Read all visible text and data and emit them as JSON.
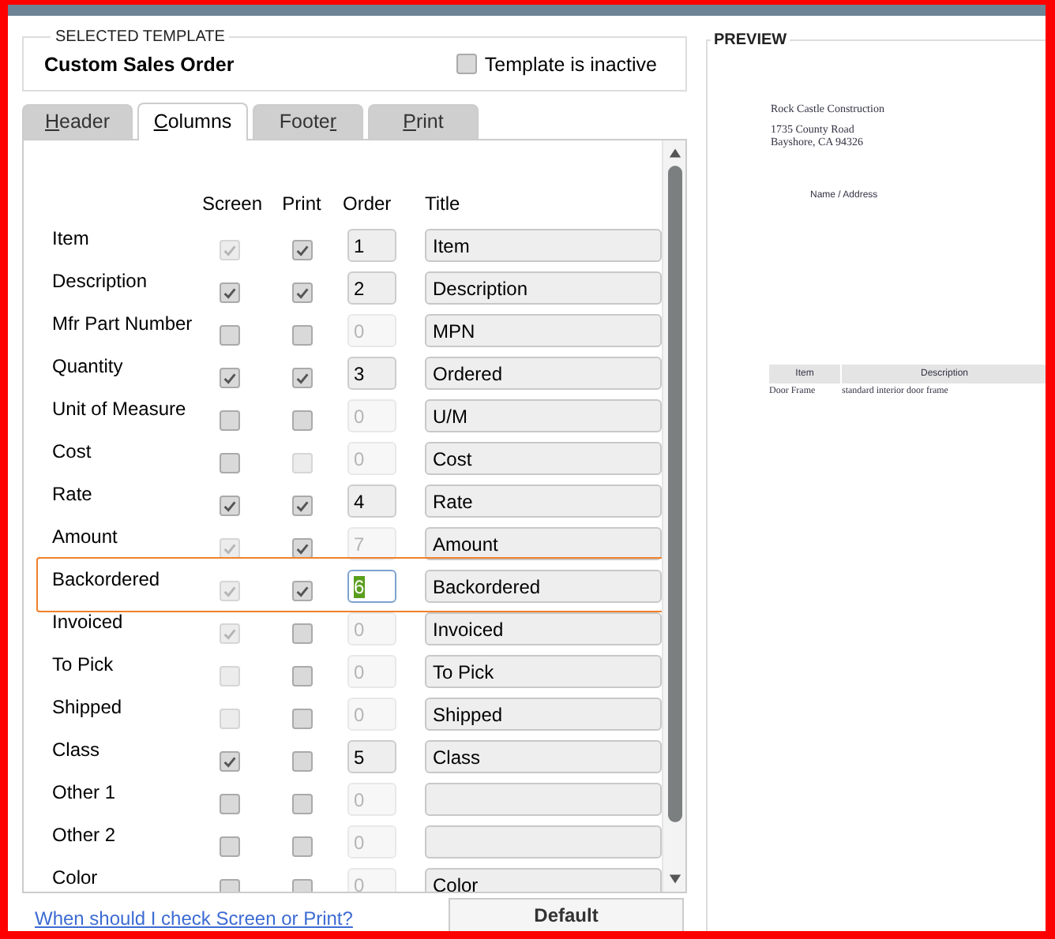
{
  "template": {
    "legend": "SELECTED TEMPLATE",
    "name": "Custom Sales Order",
    "inactive_label": "Template is inactive",
    "inactive": false
  },
  "tabs": [
    {
      "key": "H",
      "after": "eader",
      "selected": false
    },
    {
      "key": "C",
      "after": "olumns",
      "selected": true
    },
    {
      "before": "Foote",
      "key": "r",
      "selected": false
    },
    {
      "key": "P",
      "after": "rint",
      "selected": false
    }
  ],
  "headers": {
    "screen": "Screen",
    "print": "Print",
    "order": "Order",
    "title": "Title"
  },
  "rows": [
    {
      "label": "Item",
      "screen": {
        "checked": true,
        "disabled": true
      },
      "print": {
        "checked": true,
        "disabled": false
      },
      "order": {
        "value": "1",
        "disabled": false,
        "focused": false
      },
      "title": "Item",
      "highlighted": false
    },
    {
      "label": "Description",
      "screen": {
        "checked": true,
        "disabled": false
      },
      "print": {
        "checked": true,
        "disabled": false
      },
      "order": {
        "value": "2",
        "disabled": false,
        "focused": false
      },
      "title": "Description",
      "highlighted": false
    },
    {
      "label": "Mfr Part Number",
      "screen": {
        "checked": false,
        "disabled": false
      },
      "print": {
        "checked": false,
        "disabled": false
      },
      "order": {
        "value": "0",
        "disabled": true,
        "focused": false
      },
      "title": "MPN",
      "highlighted": false
    },
    {
      "label": "Quantity",
      "screen": {
        "checked": true,
        "disabled": false
      },
      "print": {
        "checked": true,
        "disabled": false
      },
      "order": {
        "value": "3",
        "disabled": false,
        "focused": false
      },
      "title": "Ordered",
      "highlighted": false
    },
    {
      "label": "Unit of Measure",
      "screen": {
        "checked": false,
        "disabled": false
      },
      "print": {
        "checked": false,
        "disabled": false
      },
      "order": {
        "value": "0",
        "disabled": true,
        "focused": false
      },
      "title": "U/M",
      "highlighted": false
    },
    {
      "label": "Cost",
      "screen": {
        "checked": false,
        "disabled": false
      },
      "print": {
        "checked": false,
        "disabled": true
      },
      "order": {
        "value": "0",
        "disabled": true,
        "focused": false
      },
      "title": "Cost",
      "highlighted": false
    },
    {
      "label": "Rate",
      "screen": {
        "checked": true,
        "disabled": false
      },
      "print": {
        "checked": true,
        "disabled": false
      },
      "order": {
        "value": "4",
        "disabled": false,
        "focused": false
      },
      "title": "Rate",
      "highlighted": false
    },
    {
      "label": "Amount",
      "screen": {
        "checked": true,
        "disabled": true
      },
      "print": {
        "checked": true,
        "disabled": false
      },
      "order": {
        "value": "7",
        "disabled": true,
        "focused": false
      },
      "title": "Amount",
      "highlighted": false
    },
    {
      "label": "Backordered",
      "screen": {
        "checked": true,
        "disabled": true
      },
      "print": {
        "checked": true,
        "disabled": false
      },
      "order": {
        "value": "6",
        "disabled": false,
        "focused": true
      },
      "title": "Backordered",
      "highlighted": true
    },
    {
      "label": "Invoiced",
      "screen": {
        "checked": true,
        "disabled": true
      },
      "print": {
        "checked": false,
        "disabled": false
      },
      "order": {
        "value": "0",
        "disabled": true,
        "focused": false
      },
      "title": "Invoiced",
      "highlighted": false
    },
    {
      "label": "To Pick",
      "screen": {
        "checked": false,
        "disabled": true
      },
      "print": {
        "checked": false,
        "disabled": false
      },
      "order": {
        "value": "0",
        "disabled": true,
        "focused": false
      },
      "title": "To Pick",
      "highlighted": false
    },
    {
      "label": "Shipped",
      "screen": {
        "checked": false,
        "disabled": true
      },
      "print": {
        "checked": false,
        "disabled": false
      },
      "order": {
        "value": "0",
        "disabled": true,
        "focused": false
      },
      "title": "Shipped",
      "highlighted": false
    },
    {
      "label": "Class",
      "screen": {
        "checked": true,
        "disabled": false
      },
      "print": {
        "checked": false,
        "disabled": false
      },
      "order": {
        "value": "5",
        "disabled": false,
        "focused": false
      },
      "title": "Class",
      "highlighted": false
    },
    {
      "label": "Other 1",
      "screen": {
        "checked": false,
        "disabled": false
      },
      "print": {
        "checked": false,
        "disabled": false
      },
      "order": {
        "value": "0",
        "disabled": true,
        "focused": false
      },
      "highlighted": false
    },
    {
      "label": "Other 2",
      "screen": {
        "checked": false,
        "disabled": false
      },
      "print": {
        "checked": false,
        "disabled": false
      },
      "order": {
        "value": "0",
        "disabled": true,
        "focused": false
      },
      "highlighted": false
    },
    {
      "label": "Color",
      "screen": {
        "checked": false,
        "disabled": false
      },
      "print": {
        "checked": false,
        "disabled": false
      },
      "order": {
        "value": "0",
        "disabled": true,
        "focused": false
      },
      "title": "Color",
      "highlighted": false
    }
  ],
  "help_link": "When should I check Screen or Print?",
  "default_button": "Default",
  "preview": {
    "legend": "PREVIEW",
    "company": "Rock Castle Construction",
    "address": [
      "1735 County Road",
      "Bayshore, CA 94326"
    ],
    "name_address": "Name / Address",
    "columns": [
      "Item",
      "Description"
    ],
    "line": [
      "Door Frame",
      "standard interior door frame"
    ]
  }
}
